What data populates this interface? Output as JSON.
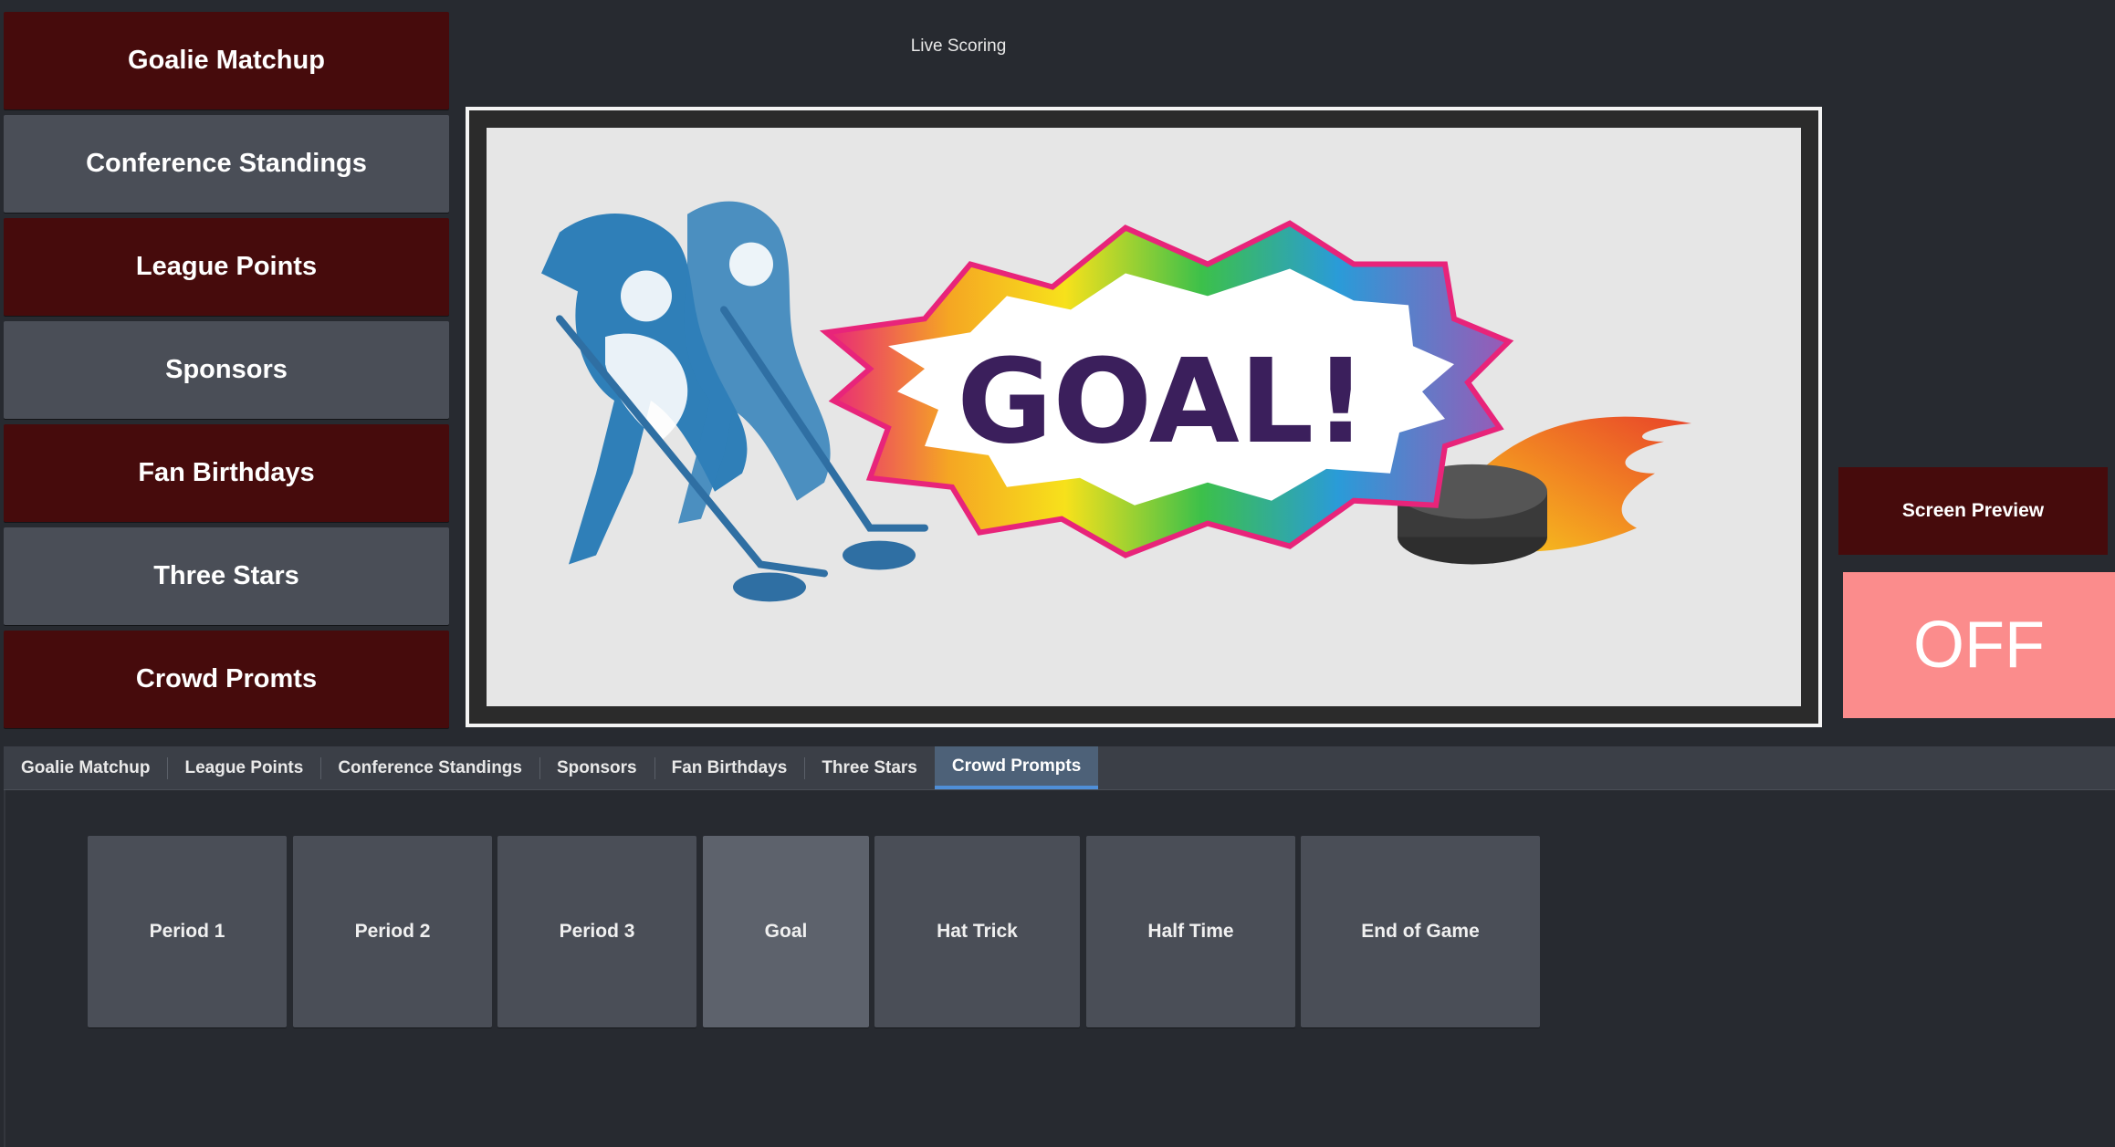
{
  "nav": {
    "items": [
      {
        "label": "Goalie Matchup",
        "color": "#460b0c"
      },
      {
        "label": "Conference Standings",
        "color": "#4a4e57"
      },
      {
        "label": "League Points",
        "color": "#460b0c"
      },
      {
        "label": "Sponsors",
        "color": "#4a4e57"
      },
      {
        "label": "Fan Birthdays",
        "color": "#460b0c"
      },
      {
        "label": "Three Stars",
        "color": "#4a4e57"
      },
      {
        "label": "Crowd Promts",
        "color": "#460b0c"
      }
    ]
  },
  "header": {
    "title": "Live Scoring"
  },
  "preview": {
    "graphic_text": "GOAL!",
    "graphic_text_color": "#3b1f5c"
  },
  "controls": {
    "screen_preview_label": "Screen Preview",
    "off_label": "OFF",
    "off_color": "#fb8c8c"
  },
  "tabs": {
    "items": [
      {
        "label": "Goalie Matchup",
        "active": false
      },
      {
        "label": "League Points",
        "active": false
      },
      {
        "label": "Conference Standings",
        "active": false
      },
      {
        "label": "Sponsors",
        "active": false
      },
      {
        "label": "Fan Birthdays",
        "active": false
      },
      {
        "label": "Three Stars",
        "active": false
      },
      {
        "label": "Crowd Prompts",
        "active": true
      }
    ]
  },
  "prompts": {
    "items": [
      {
        "label": "Period 1",
        "selected": false
      },
      {
        "label": "Period 2",
        "selected": false
      },
      {
        "label": "Period 3",
        "selected": false
      },
      {
        "label": "Goal",
        "selected": true
      },
      {
        "label": "Hat Trick",
        "selected": false
      },
      {
        "label": "Half Time",
        "selected": false
      },
      {
        "label": "End of Game",
        "selected": false
      }
    ]
  }
}
